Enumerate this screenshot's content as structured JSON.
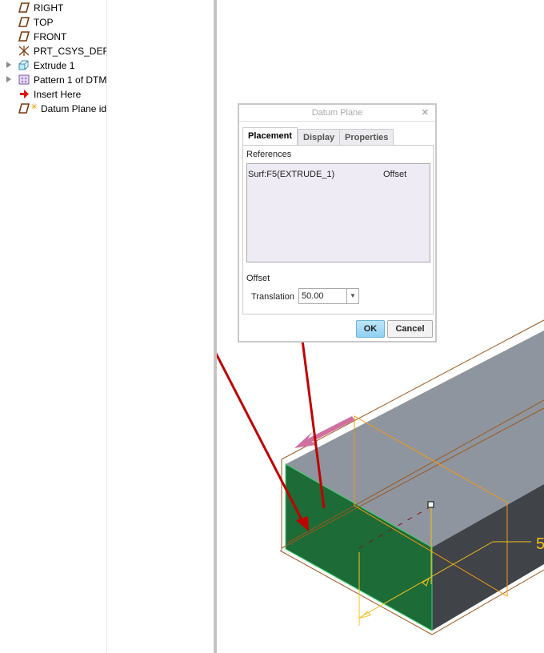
{
  "model_tree": {
    "items": [
      {
        "label": "RIGHT",
        "icon": "datum-plane-icon",
        "expandable": false
      },
      {
        "label": "TOP",
        "icon": "datum-plane-icon",
        "expandable": false
      },
      {
        "label": "FRONT",
        "icon": "datum-plane-icon",
        "expandable": false
      },
      {
        "label": "PRT_CSYS_DEF",
        "icon": "csys-icon",
        "expandable": false
      },
      {
        "label": "Extrude 1",
        "icon": "extrude-icon",
        "expandable": true
      },
      {
        "label": "Pattern 1 of DTM",
        "icon": "pattern-icon",
        "expandable": true
      },
      {
        "label": "Insert Here",
        "icon": "insert-arrow-icon",
        "expandable": false
      },
      {
        "label": "Datum Plane id",
        "icon": "datum-plane-new-icon",
        "expandable": false
      }
    ]
  },
  "dialog": {
    "title": "Datum Plane",
    "tabs": [
      "Placement",
      "Display",
      "Properties"
    ],
    "active_tab": "Placement",
    "references_label": "References",
    "reference": {
      "name": "Surf:F5(EXTRUDE_1)",
      "constraint": "Offset"
    },
    "offset_label": "Offset",
    "translation_label": "Translation",
    "translation_value": "50.00",
    "ok": "OK",
    "cancel": "Cancel"
  },
  "viewport": {
    "dimension_label": "5"
  }
}
